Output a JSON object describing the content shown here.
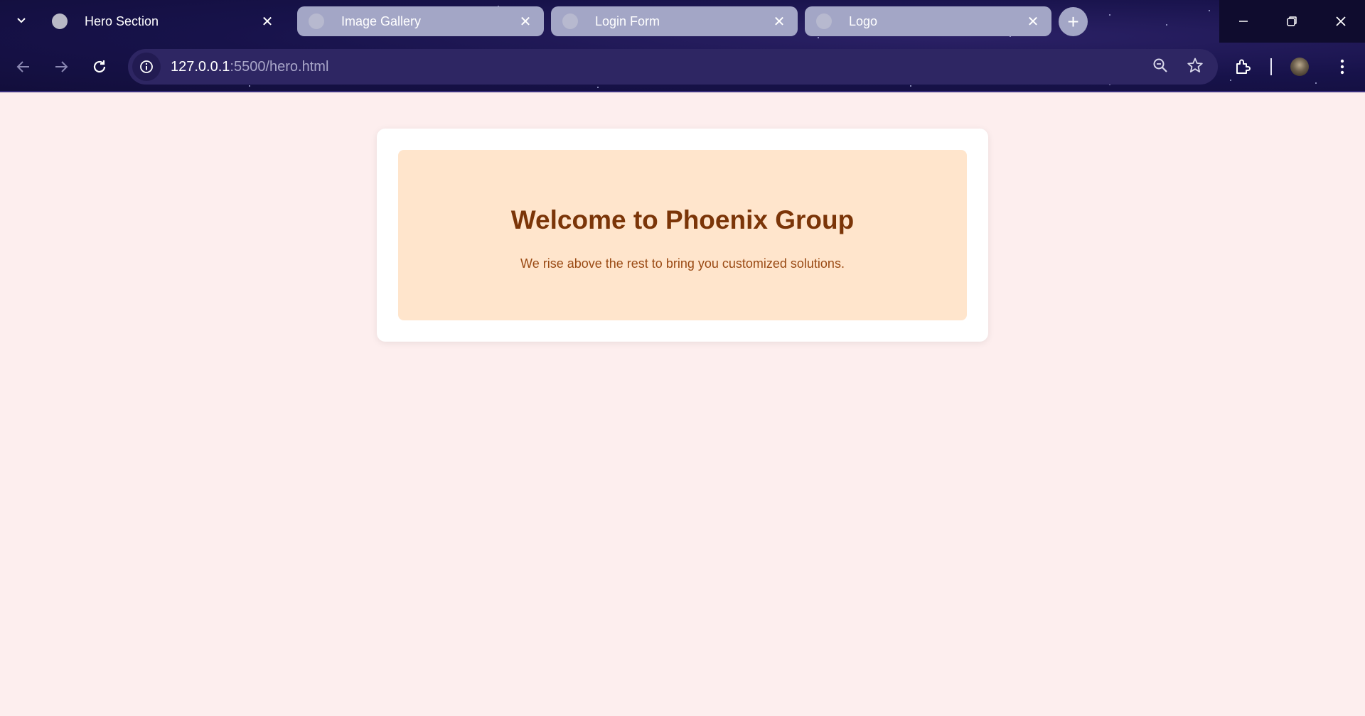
{
  "browser": {
    "tabs": [
      {
        "title": "Hero Section",
        "active": true
      },
      {
        "title": "Image Gallery",
        "active": false
      },
      {
        "title": "Login Form",
        "active": false
      },
      {
        "title": "Logo",
        "active": false
      }
    ],
    "close_glyph": "✕",
    "new_tab_glyph": "+",
    "url_host": "127.0.0.1",
    "url_path": ":5500/hero.html",
    "window_controls": {
      "minimize": "—",
      "restore": "❐",
      "close": "✕"
    }
  },
  "hero": {
    "heading": "Welcome to Phoenix Group",
    "subtext": "We rise above the rest to bring you customized solutions."
  },
  "colors": {
    "page_bg": "#fdeeee",
    "hero_bg": "#ffe5cc",
    "heading": "#7b3508",
    "subtext": "#9a4a14"
  },
  "icons": [
    "tab-search-icon",
    "globe-icon",
    "close-icon",
    "plus-icon",
    "back-arrow-icon",
    "forward-arrow-icon",
    "reload-icon",
    "info-icon",
    "zoom-icon",
    "star-icon",
    "extensions-icon",
    "avatar",
    "more-vert-icon",
    "minimize-icon",
    "restore-icon"
  ]
}
